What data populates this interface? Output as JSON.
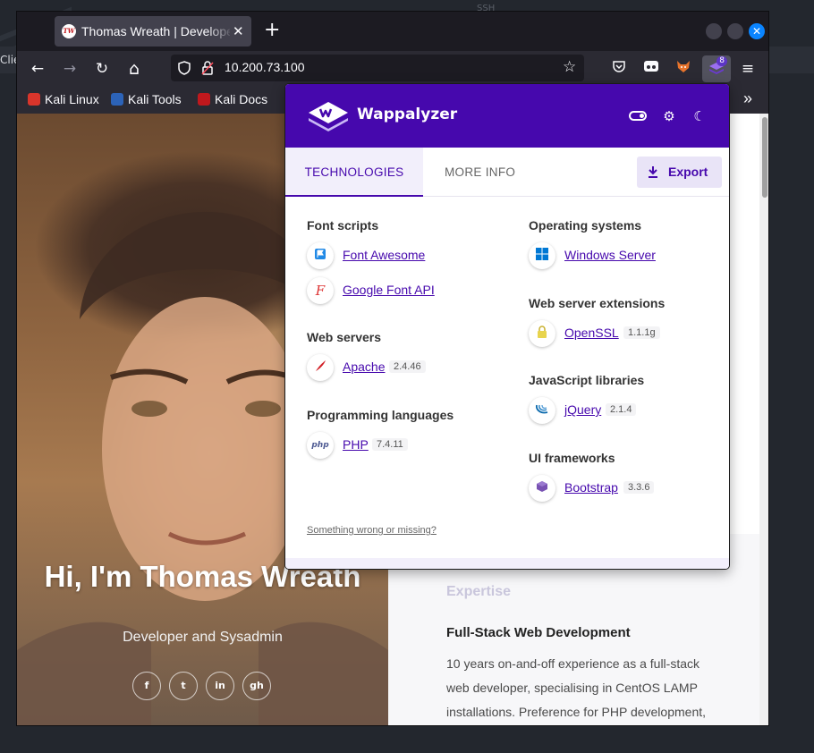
{
  "desktop": {
    "background_label": "SSH",
    "behind_window_text": "Clie"
  },
  "browser": {
    "tab": {
      "favicon_text": "TW",
      "title": "Thomas Wreath | Developer",
      "close": "✕"
    },
    "new_tab": "+",
    "window_controls": {
      "close": "✕"
    },
    "nav": {
      "back": "←",
      "forward": "→",
      "reload": "↻",
      "home": "⌂"
    },
    "url": "10.200.73.100",
    "bookmark_star": "☆",
    "extensions": {
      "wappalyzer_badge": "8"
    },
    "menu": "≡",
    "bookmarks": [
      {
        "label": "Kali Linux",
        "color": "#d9352b"
      },
      {
        "label": "Kali Tools",
        "color": "#2c63b8"
      },
      {
        "label": "Kali Docs",
        "color": "#c0181d"
      }
    ],
    "bookmarks_overflow": "»"
  },
  "page": {
    "hero_name": "Hi, I'm Thomas Wreath",
    "hero_subtitle": "Developer and Sysadmin",
    "social": [
      "f",
      "t",
      "in",
      "gh"
    ],
    "expertise_heading": "Expertise",
    "fullstack_title": "Full-Stack Web Development",
    "fullstack_desc": "10 years on-and-off experience as a full-stack web developer, specialising in CentOS LAMP installations. Preference for PHP development, but with extensive knowledge"
  },
  "wappalyzer": {
    "title": "Wappalyzer",
    "colors": {
      "brand": "#4608ad"
    },
    "tabs": {
      "technologies": "TECHNOLOGIES",
      "more_info": "MORE INFO"
    },
    "export_label": "Export",
    "left_categories": [
      {
        "name": "Font scripts",
        "items": [
          {
            "name": "Font Awesome",
            "version": "",
            "icon": "flag-icon"
          },
          {
            "name": "Google Font API",
            "version": "",
            "icon": "google-font-icon"
          }
        ]
      },
      {
        "name": "Web servers",
        "items": [
          {
            "name": "Apache",
            "version": "2.4.46",
            "icon": "feather-icon"
          }
        ]
      },
      {
        "name": "Programming languages",
        "items": [
          {
            "name": "PHP",
            "version": "7.4.11",
            "icon": "php-icon"
          }
        ]
      }
    ],
    "right_categories": [
      {
        "name": "Operating systems",
        "items": [
          {
            "name": "Windows Server",
            "version": "",
            "icon": "windows-icon"
          }
        ]
      },
      {
        "name": "Web server extensions",
        "items": [
          {
            "name": "OpenSSL",
            "version": "1.1.1g",
            "icon": "lock-icon"
          }
        ]
      },
      {
        "name": "JavaScript libraries",
        "items": [
          {
            "name": "jQuery",
            "version": "2.1.4",
            "icon": "jquery-icon"
          }
        ]
      },
      {
        "name": "UI frameworks",
        "items": [
          {
            "name": "Bootstrap",
            "version": "3.3.6",
            "icon": "bootstrap-icon"
          }
        ]
      }
    ],
    "footer_link": "Something wrong or missing?"
  }
}
